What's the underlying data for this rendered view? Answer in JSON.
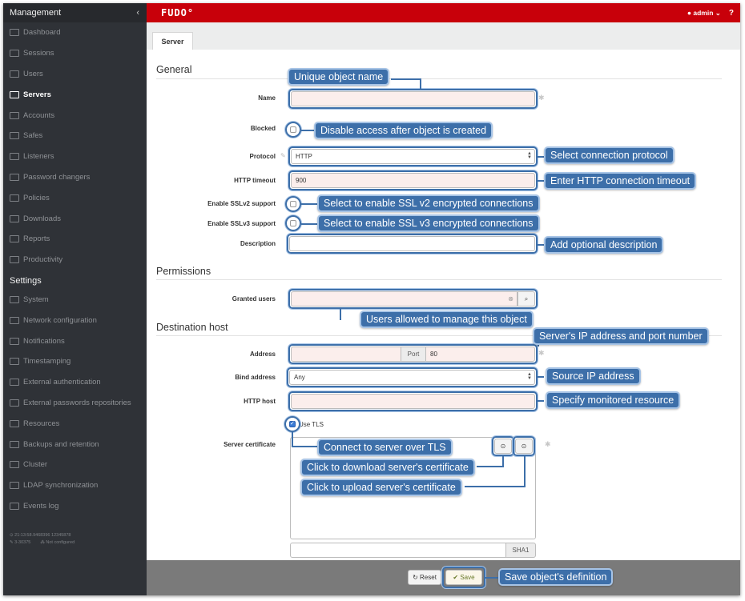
{
  "sidebar": {
    "management_title": "Management",
    "collapse_icon": "chevron-left-icon",
    "management_items": [
      {
        "label": "Dashboard",
        "icon": "chart-icon"
      },
      {
        "label": "Sessions",
        "icon": "film-icon"
      },
      {
        "label": "Users",
        "icon": "users-icon"
      },
      {
        "label": "Servers",
        "icon": "server-icon",
        "active": true
      },
      {
        "label": "Accounts",
        "icon": "accounts-icon"
      },
      {
        "label": "Safes",
        "icon": "safe-icon"
      },
      {
        "label": "Listeners",
        "icon": "listener-icon"
      },
      {
        "label": "Password changers",
        "icon": "key-icon"
      },
      {
        "label": "Policies",
        "icon": "shield-icon"
      },
      {
        "label": "Downloads",
        "icon": "download-icon"
      },
      {
        "label": "Reports",
        "icon": "print-icon"
      },
      {
        "label": "Productivity",
        "icon": "list-icon"
      }
    ],
    "settings_title": "Settings",
    "settings_items": [
      {
        "label": "System",
        "icon": "folder-icon"
      },
      {
        "label": "Network configuration",
        "icon": "network-icon"
      },
      {
        "label": "Notifications",
        "icon": "mail-icon"
      },
      {
        "label": "Timestamping",
        "icon": "edit-icon"
      },
      {
        "label": "External authentication",
        "icon": "key-icon"
      },
      {
        "label": "External passwords repositories",
        "icon": "grid-icon"
      },
      {
        "label": "Resources",
        "icon": "image-icon"
      },
      {
        "label": "Backups and retention",
        "icon": "archive-icon"
      },
      {
        "label": "Cluster",
        "icon": "sitemap-icon"
      },
      {
        "label": "LDAP synchronization",
        "icon": "sync-icon"
      },
      {
        "label": "Events log",
        "icon": "list-icon"
      }
    ],
    "footer": {
      "time": "⊙ 21:13:58.9468396 12345878",
      "version": "✎ 3-30375",
      "cluster": "⁂ Not configured"
    }
  },
  "topbar": {
    "logo": "FUDO°",
    "user": "admin",
    "help": "?"
  },
  "tabs": [
    "Server"
  ],
  "form": {
    "general_title": "General",
    "name_label": "Name",
    "blocked_label": "Blocked",
    "protocol_label": "Protocol",
    "protocol_value": "HTTP",
    "http_timeout_label": "HTTP timeout",
    "http_timeout_value": "900",
    "sslv2_label": "Enable SSLv2 support",
    "sslv3_label": "Enable SSLv3 support",
    "description_label": "Description",
    "permissions_title": "Permissions",
    "granted_users_label": "Granted users",
    "destination_title": "Destination host",
    "address_label": "Address",
    "port_label": "Port",
    "port_value": "80",
    "bind_address_label": "Bind address",
    "bind_address_value": "Any",
    "http_host_label": "HTTP host",
    "use_tls_label": "Use TLS",
    "use_tls_checked": true,
    "server_certificate_label": "Server certificate",
    "sha_label": "SHA1"
  },
  "callouts": {
    "name": "Unique object name",
    "blocked": "Disable access after object is created",
    "protocol": "Select connection protocol",
    "timeout": "Enter HTTP connection timeout",
    "sslv2": "Select to enable SSL v2 encrypted connections",
    "sslv3": "Select to enable SSL v3 encrypted connections",
    "description": "Add optional description",
    "granted": "Users allowed to manage this object",
    "address": "Server's IP address and port number",
    "bind": "Source IP address",
    "http_host": "Specify monitored resource",
    "tls": "Connect to server over TLS",
    "download": "Click to download server's certificate",
    "upload": "Click to upload server's certificate",
    "save": "Save object's definition"
  },
  "buttons": {
    "reset": "Reset",
    "save": "Save"
  },
  "colors": {
    "accent_red": "#c8000a",
    "sidebar": "#2f3237",
    "callout": "#3d6fa9",
    "required_field": "#fbeeec"
  }
}
